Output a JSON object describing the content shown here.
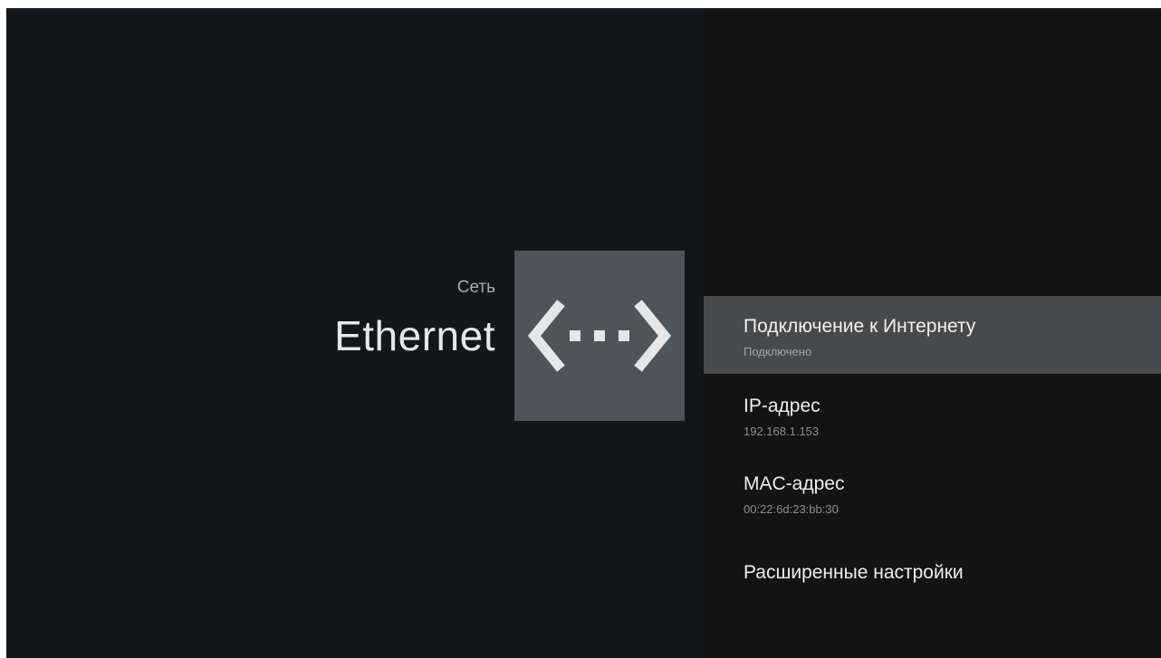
{
  "header": {
    "breadcrumb": "Сеть",
    "title": "Ethernet",
    "icon": "ethernet-icon"
  },
  "menu": {
    "items": [
      {
        "title": "Подключение к Интернету",
        "subtitle": "Подключено",
        "selected": true
      },
      {
        "title": "IP-адрес",
        "subtitle": "192.168.1.153",
        "selected": false
      },
      {
        "title": "MAC-адрес",
        "subtitle": "00:22:6d:23:bb:30",
        "selected": false
      },
      {
        "title": "Расширенные настройки",
        "subtitle": "",
        "selected": false
      }
    ]
  },
  "colors": {
    "left_background": "#131719",
    "right_background": "#131313",
    "selected_row": "#48494a",
    "icon_tile": "#4f5458"
  }
}
